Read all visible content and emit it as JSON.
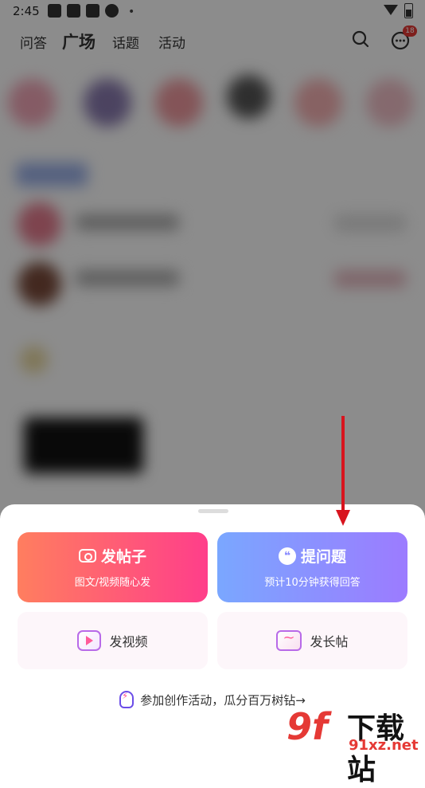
{
  "status_bar": {
    "time": "2:45",
    "dot": "•"
  },
  "top_nav": {
    "tabs": [
      {
        "label": "问答"
      },
      {
        "label": "广场"
      },
      {
        "label": "话题"
      },
      {
        "label": "活动"
      }
    ],
    "active_tab": "广场",
    "message_badge": "18"
  },
  "sheet": {
    "post": {
      "title": "发帖子",
      "subtitle": "图文/视频随心发"
    },
    "ask": {
      "title": "提问题",
      "subtitle": "预计10分钟获得回答",
      "icon_glyph": "❝"
    },
    "video": {
      "label": "发视频"
    },
    "long_post": {
      "label": "发长帖"
    },
    "promo": "参加创作活动，瓜分百万树钻→"
  },
  "watermark": {
    "logo": "9f",
    "name": "下载站",
    "domain": "91xz.net"
  },
  "colors": {
    "post_gradient": [
      "#ff7e5f",
      "#ff3e8a"
    ],
    "ask_gradient": [
      "#7aa7ff",
      "#9c7bff"
    ],
    "annotation_arrow": "#d8141e",
    "badge": "#e53935"
  }
}
